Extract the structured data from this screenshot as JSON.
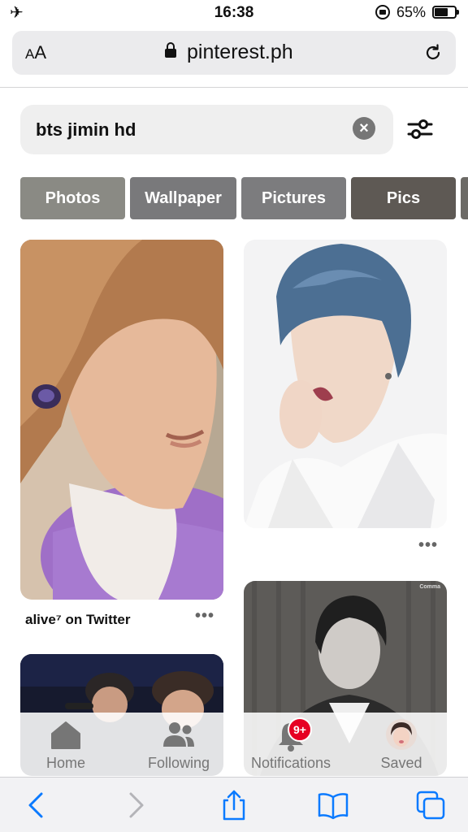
{
  "status_bar": {
    "time": "16:38",
    "battery_percent": "65%",
    "battery_level": 0.65,
    "airplane_icon": "airplane-icon"
  },
  "browser": {
    "text_size_button": "AA",
    "domain": "pinterest.ph",
    "lock_icon": "padlock-icon",
    "reload_icon": "reload-icon"
  },
  "search": {
    "query": "bts jimin hd",
    "clear_icon": "clear-icon",
    "filter_icon": "filter-sliders-icon"
  },
  "chips": [
    {
      "label": "Photos",
      "color": "#8a8a84"
    },
    {
      "label": "Wallpaper",
      "color": "#79797b"
    },
    {
      "label": "Pictures",
      "color": "#7c7c7e"
    },
    {
      "label": "Pics",
      "color": "#5e5954"
    }
  ],
  "pins": [
    {
      "title": "alive⁷ on Twitter",
      "description": "photo of man with light brown hair and earbud, purple jacket"
    },
    {
      "title": "",
      "description": "photo of man with blue hair in white suit"
    },
    {
      "title": "",
      "description": "photo of two men on stage with microphone"
    },
    {
      "title": "",
      "description": "black and white photo of man in suit",
      "watermark": "Comma"
    }
  ],
  "tab_bar": {
    "items": [
      {
        "label": "Home",
        "icon": "home-icon",
        "active": true
      },
      {
        "label": "Following",
        "icon": "people-icon",
        "active": false
      },
      {
        "label": "Notifications",
        "icon": "bell-icon",
        "active": false
      },
      {
        "label": "Saved",
        "icon": "avatar",
        "active": false
      }
    ],
    "notifications_badge": "9+"
  },
  "safari_toolbar": {
    "icons": [
      "back-icon",
      "forward-icon",
      "share-icon",
      "bookmarks-icon",
      "tabs-icon"
    ]
  },
  "colors": {
    "accent_blue": "#0a7aff",
    "badge_red": "#e60023"
  }
}
